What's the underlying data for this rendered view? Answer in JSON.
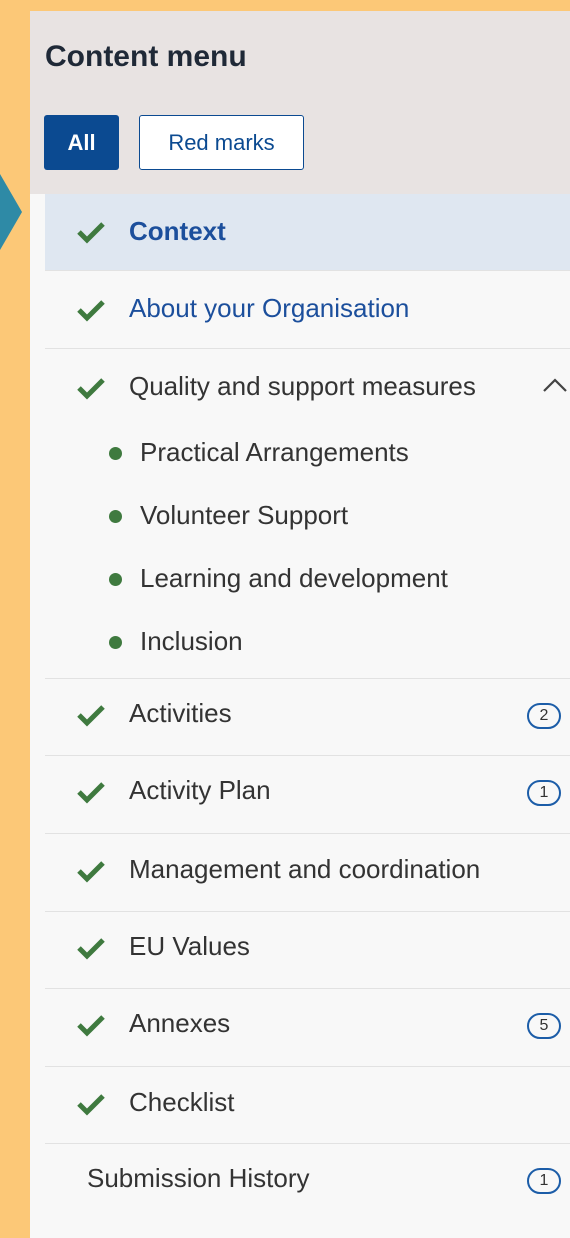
{
  "header": {
    "title": "Content menu"
  },
  "filters": {
    "all_label": "All",
    "red_marks_label": "Red marks"
  },
  "menu": {
    "items": [
      {
        "label": "Context",
        "checked": true,
        "active": true
      },
      {
        "label": "About your Organisation",
        "checked": true
      },
      {
        "label": "Quality and support measures",
        "checked": true,
        "expanded": true,
        "children": [
          "Practical Arrangements",
          "Volunteer Support",
          "Learning and development",
          "Inclusion"
        ]
      },
      {
        "label": "Activities",
        "checked": true,
        "badge": "2"
      },
      {
        "label": "Activity Plan",
        "checked": true,
        "badge": "1"
      },
      {
        "label": "Management and coordination",
        "checked": true
      },
      {
        "label": "EU Values",
        "checked": true
      },
      {
        "label": "Annexes",
        "checked": true,
        "badge": "5"
      },
      {
        "label": "Checklist",
        "checked": true
      },
      {
        "label": "Submission History",
        "checked": false,
        "badge": "1"
      }
    ]
  },
  "colors": {
    "check": "#3f7a3f",
    "accent": "#0b4a91",
    "background": "#fcc877"
  }
}
